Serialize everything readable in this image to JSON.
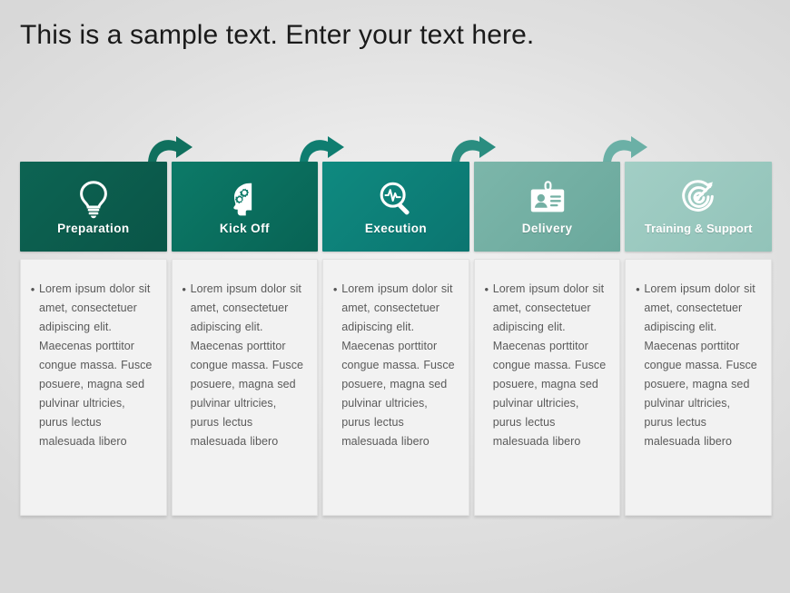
{
  "slide": {
    "title": "This is a sample text. Enter your text here.",
    "background_color": "#e8e8e8"
  },
  "process": {
    "body_text": "Lorem ipsum dolor sit amet, consectetuer adipiscing elit. Maecenas porttitor congue massa. Fusce posuere, magna sed pulvinar ultricies, purus lectus malesuada libero",
    "bullet_glyph": "•",
    "steps": [
      {
        "label": "Preparation",
        "icon": "lightbulb-icon",
        "color": "#0b5b4c",
        "body": "Lorem ipsum dolor sit amet, consectetuer adipiscing elit. Maecenas porttitor congue massa. Fusce posuere, magna sed pulvinar ultricies, purus lectus malesuada libero"
      },
      {
        "label": "Kick Off",
        "icon": "head-gears-icon",
        "color": "#0a7060",
        "body": "Lorem ipsum dolor sit amet, consectetuer adipiscing elit. Maecenas porttitor congue massa. Fusce posuere, magna sed pulvinar ultricies, purus lectus malesuada libero"
      },
      {
        "label": "Execution",
        "icon": "magnifier-pulse-icon",
        "color": "#0d8078",
        "body": "Lorem ipsum dolor sit amet, consectetuer adipiscing elit. Maecenas porttitor congue massa. Fusce posuere, magna sed pulvinar ultricies, purus lectus malesuada libero"
      },
      {
        "label": "Delivery",
        "icon": "id-badge-icon",
        "color": "#74b0a4",
        "body": "Lorem ipsum dolor sit amet, consectetuer adipiscing elit. Maecenas porttitor congue massa. Fusce posuere, magna sed pulvinar ultricies, purus lectus malesuada libero"
      },
      {
        "label": "Training  & Support",
        "icon": "target-arrow-icon",
        "color": "#9bc9c0",
        "body": "Lorem ipsum dolor sit amet, consectetuer adipiscing elit. Maecenas porttitor congue massa. Fusce posuere, magna sed pulvinar ultricies, purus lectus malesuada libero"
      }
    ],
    "arrows": [
      {
        "name": "arrow-preparation-to-kickoff",
        "color": "#10705e"
      },
      {
        "name": "arrow-kickoff-to-execution",
        "color": "#0f7d70"
      },
      {
        "name": "arrow-execution-to-delivery",
        "color": "#2a8d80"
      },
      {
        "name": "arrow-delivery-to-training",
        "color": "#6bb0a6"
      }
    ]
  }
}
